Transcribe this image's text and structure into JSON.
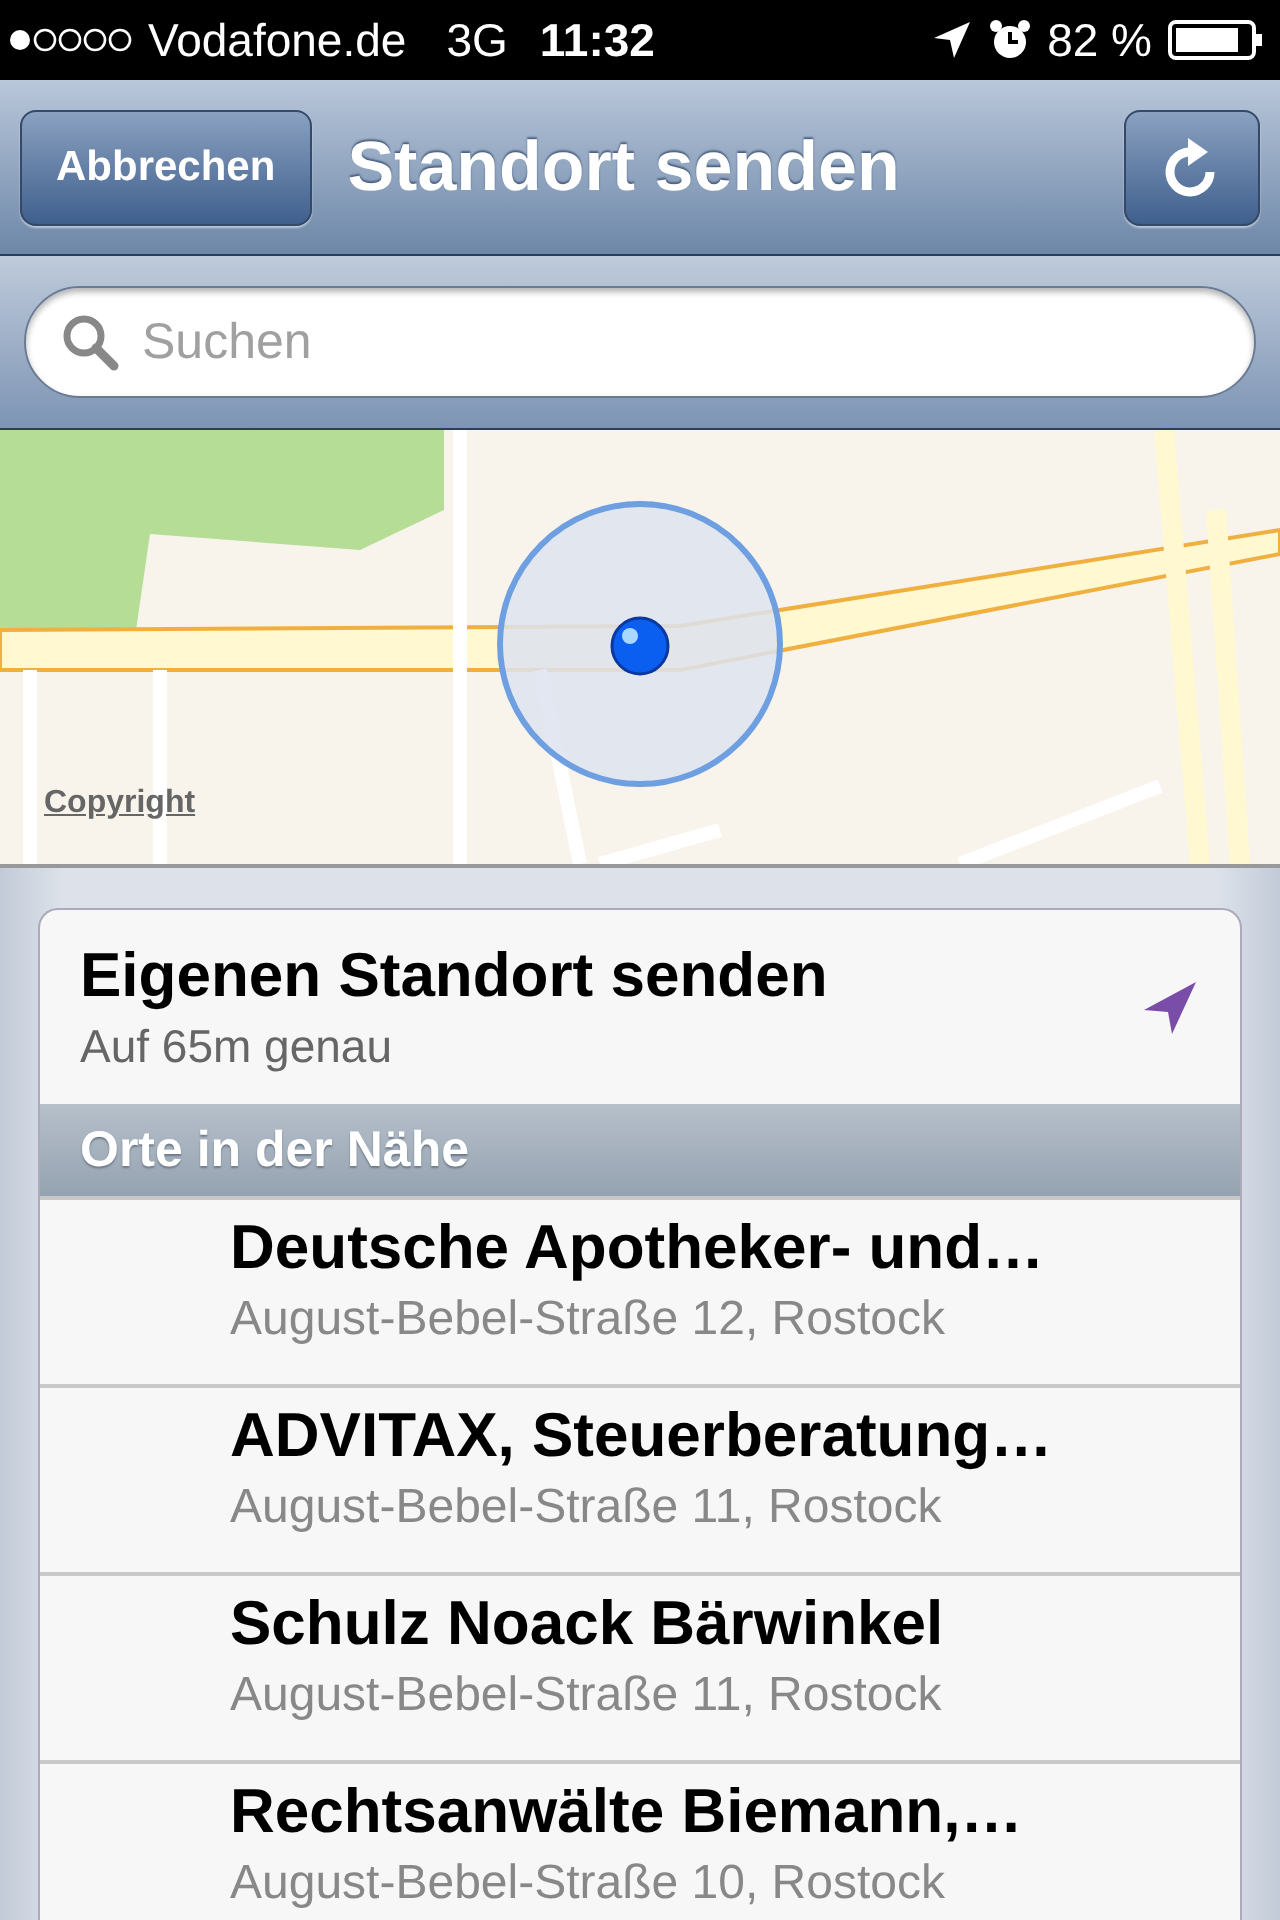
{
  "status_bar": {
    "carrier": "Vodafone.de",
    "network": "3G",
    "time": "11:32",
    "battery": "82 %"
  },
  "nav_bar": {
    "cancel": "Abbrechen",
    "title": "Standort senden"
  },
  "search": {
    "placeholder": "Suchen"
  },
  "map": {
    "kind": "picture",
    "copyright": "Copyright"
  },
  "own_location": {
    "title": "Eigenen Standort senden",
    "subtitle": "Auf 65m genau"
  },
  "section": {
    "title": "Orte in der Nähe"
  },
  "places": [
    {
      "name": "Deutsche Apotheker- und…",
      "address": "August-Bebel-Straße 12, Rostock"
    },
    {
      "name": "ADVITAX, Steuerberatung…",
      "address": "August-Bebel-Straße 11, Rostock"
    },
    {
      "name": "Schulz Noack Bärwinkel",
      "address": "August-Bebel-Straße 11, Rostock"
    },
    {
      "name": "Rechtsanwälte Biemann,…",
      "address": "August-Bebel-Straße 10, Rostock"
    }
  ]
}
